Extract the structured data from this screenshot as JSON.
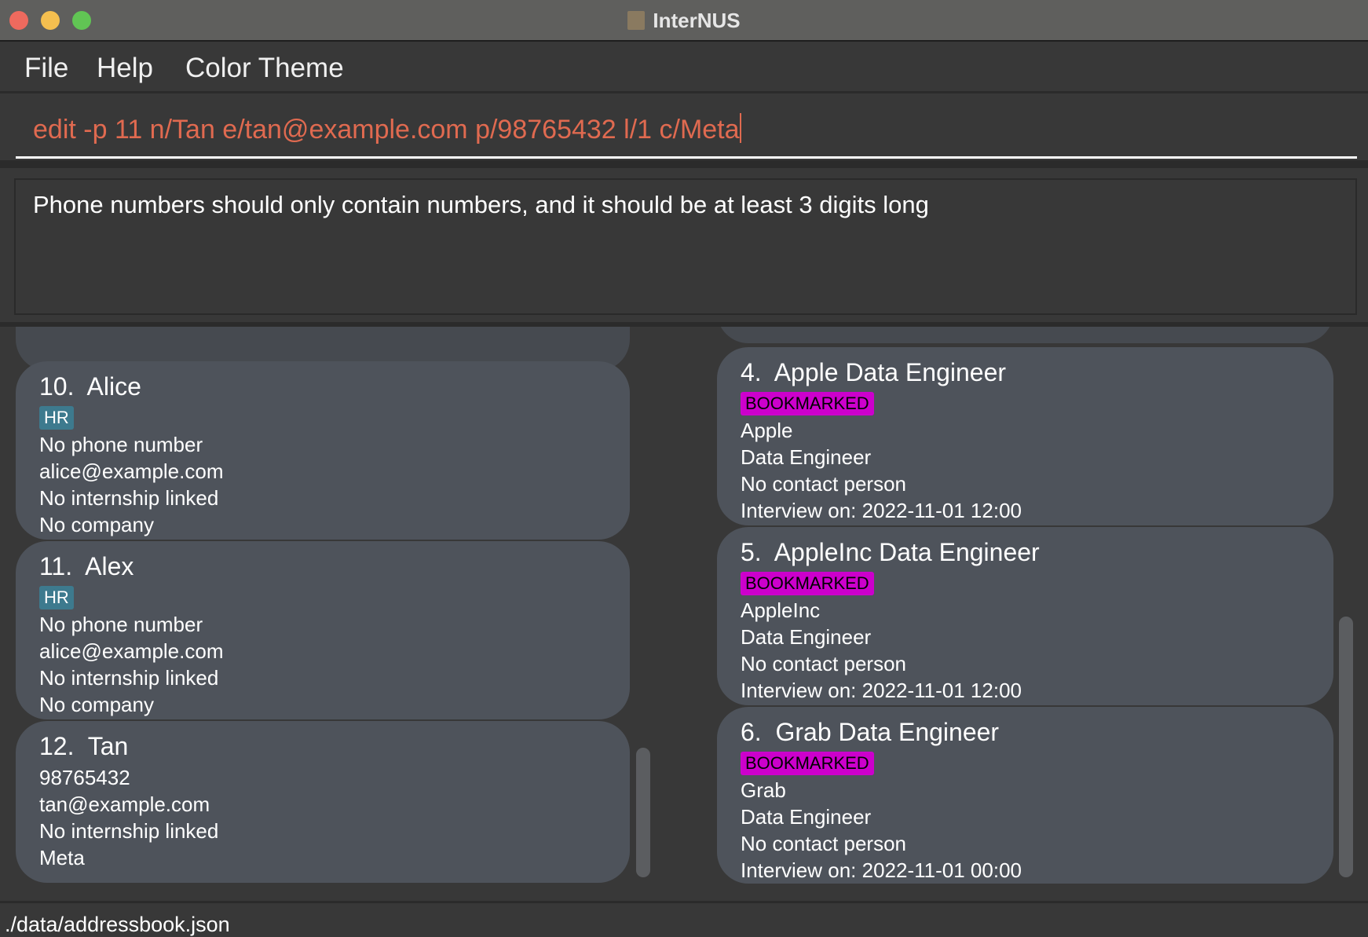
{
  "window": {
    "title": "InterNUS",
    "traffic_lights": {
      "close": "#ee6a5e",
      "minimize": "#f5bf4f",
      "maximize": "#61c554"
    }
  },
  "menu": [
    "File",
    "Help",
    "Color Theme"
  ],
  "command": {
    "value": "edit -p 11 n/Tan e/tan@example.com p/98765432 l/1 c/Meta"
  },
  "result": {
    "message": "Phone numbers should only contain numbers, and it should be at least 3 digits long"
  },
  "persons": [
    {
      "index": "10.",
      "name": "Alice",
      "tags": [
        "HR"
      ],
      "phone": "No phone number",
      "email": "alice@example.com",
      "internship": "No internship linked",
      "company": "No company"
    },
    {
      "index": "11.",
      "name": "Alex",
      "tags": [
        "HR"
      ],
      "phone": "No phone number",
      "email": "alice@example.com",
      "internship": "No internship linked",
      "company": "No company"
    },
    {
      "index": "12.",
      "name": "Tan",
      "tags": [],
      "phone": "98765432",
      "email": "tan@example.com",
      "internship": "No internship linked",
      "company": "Meta"
    }
  ],
  "internships": [
    {
      "index": "4.",
      "title": "Apple Data Engineer",
      "status": "BOOKMARKED",
      "company": "Apple",
      "role": "Data Engineer",
      "contact": "No contact person",
      "interview": "Interview on: 2022-11-01 12:00"
    },
    {
      "index": "5.",
      "title": "AppleInc Data Engineer",
      "status": "BOOKMARKED",
      "company": "AppleInc",
      "role": "Data Engineer",
      "contact": "No contact person",
      "interview": "Interview on: 2022-11-01 12:00"
    },
    {
      "index": "6.",
      "title": "Grab Data Engineer",
      "status": "BOOKMARKED",
      "company": "Grab",
      "role": "Data Engineer",
      "contact": "No contact person",
      "interview": "Interview on: 2022-11-01 00:00"
    }
  ],
  "status_bar": {
    "path": "./data/addressbook.json"
  },
  "colors": {
    "command_text": "#e06a50",
    "tag_hr": "#3d7a8e",
    "tag_bookmarked": "#cc00cc",
    "card": "#4e535b"
  }
}
